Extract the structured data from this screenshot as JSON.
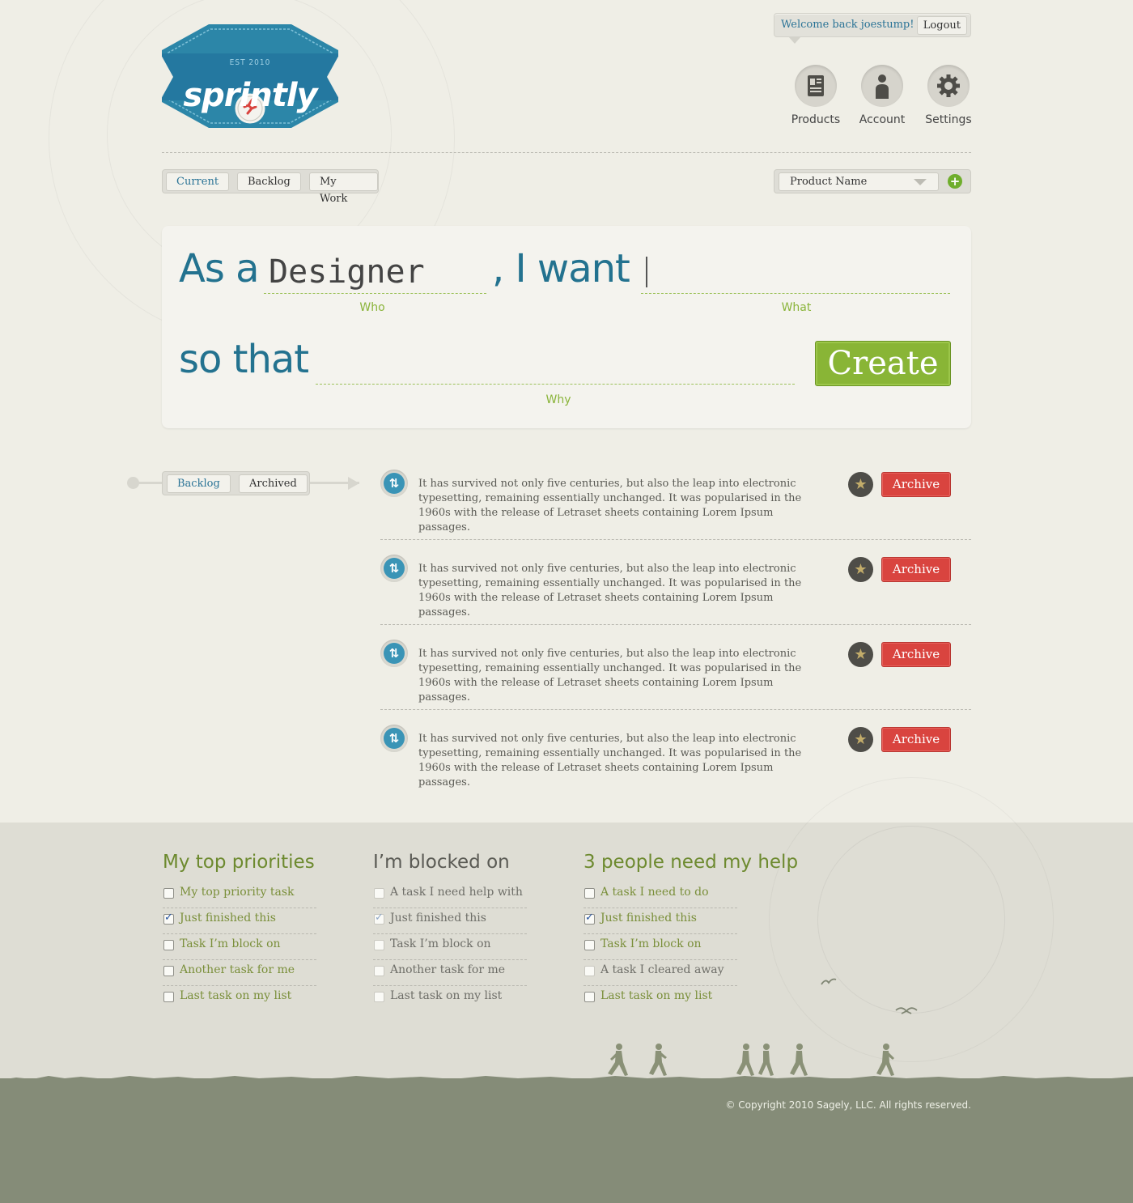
{
  "brand": {
    "name": "sprintly",
    "est": "EST 2010"
  },
  "header": {
    "welcome": "Welcome back joestump!",
    "logout": "Logout",
    "nav": [
      {
        "label": "Products",
        "icon": "products-icon"
      },
      {
        "label": "Account",
        "icon": "account-icon"
      },
      {
        "label": "Settings",
        "icon": "gear-icon"
      }
    ]
  },
  "tabs": {
    "items": [
      "Current",
      "Backlog",
      "My Work"
    ],
    "active": "Current"
  },
  "product_select": {
    "value": "Product Name"
  },
  "story_form": {
    "as_a": "As a",
    "who_value": "Designer",
    "i_want": ", I want",
    "so_that": "so that",
    "who_label": "Who",
    "what_label": "What",
    "why_label": "Why",
    "create_label": "Create"
  },
  "list_tabs": {
    "items": [
      "Backlog",
      "Archived"
    ],
    "active": "Backlog"
  },
  "stories": [
    {
      "text": "It has survived not only five centuries, but also the leap into electronic typesetting, remaining essentially unchanged. It was popularised in the 1960s with the release of Letraset sheets containing Lorem Ipsum passages.",
      "action": "Archive"
    },
    {
      "text": "It has survived not only five centuries, but also the leap into electronic typesetting, remaining essentially unchanged. It was popularised in the 1960s with the release of Letraset sheets containing Lorem Ipsum passages.",
      "action": "Archive"
    },
    {
      "text": "It has survived not only five centuries, but also the leap into electronic typesetting, remaining essentially unchanged. It was popularised in the 1960s with the release of Letraset sheets containing Lorem Ipsum passages.",
      "action": "Archive"
    },
    {
      "text": "It has survived not only five centuries, but also the leap into electronic typesetting, remaining essentially unchanged. It was popularised in the 1960s with the release of Letraset sheets containing Lorem Ipsum passages.",
      "action": "Archive"
    }
  ],
  "columns": [
    {
      "title": "My top priorities",
      "muted": false,
      "tasks": [
        {
          "label": "My top priority task",
          "checked": false
        },
        {
          "label": "Just finished this",
          "checked": true
        },
        {
          "label": "Task I’m block on",
          "checked": false
        },
        {
          "label": "Another task for me",
          "checked": false
        },
        {
          "label": "Last task on my list",
          "checked": false
        }
      ]
    },
    {
      "title": "I’m blocked on",
      "muted": true,
      "tasks": [
        {
          "label": "A task I need help with",
          "checked": false
        },
        {
          "label": "Just finished this",
          "checked": true
        },
        {
          "label": "Task I’m block on",
          "checked": false
        },
        {
          "label": "Another task for me",
          "checked": false
        },
        {
          "label": "Last task on my list",
          "checked": false
        }
      ]
    },
    {
      "title": "3 people need my help",
      "muted": false,
      "tasks": [
        {
          "label": "A task I need to do",
          "checked": false
        },
        {
          "label": "Just finished this",
          "checked": true
        },
        {
          "label": "Task I’m block on",
          "checked": false
        },
        {
          "label": "A task I cleared away",
          "checked": false,
          "muted": true
        },
        {
          "label": "Last task on my list",
          "checked": false
        }
      ]
    }
  ],
  "footer": {
    "copyright": "© Copyright 2010 Sagely, LLC. All rights reserved."
  },
  "colors": {
    "brand_blue": "#23728f",
    "accent_green": "#89b536",
    "archive_red": "#d9443f",
    "ground": "#858c78"
  }
}
